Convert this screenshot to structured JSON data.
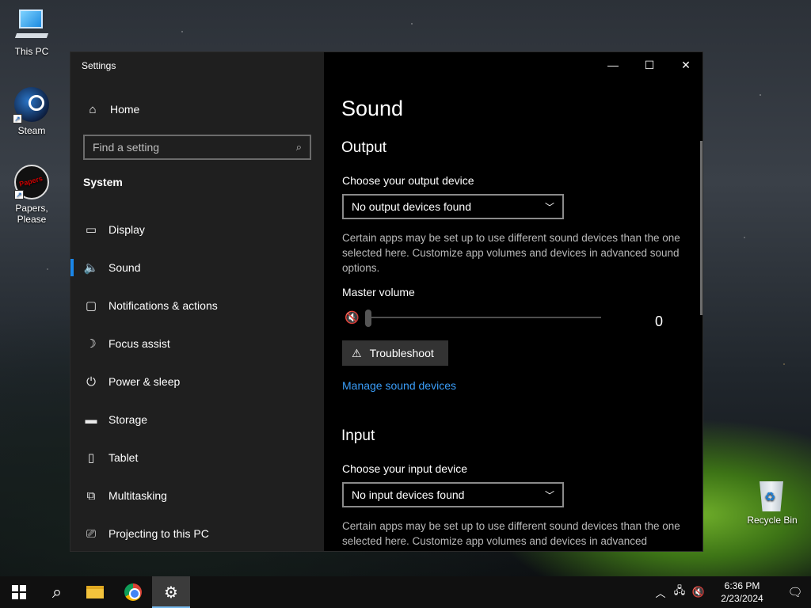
{
  "desktop": {
    "icons": [
      {
        "label": "This PC"
      },
      {
        "label": "Steam"
      },
      {
        "label": "Papers, Please"
      },
      {
        "label": "Recycle Bin"
      }
    ]
  },
  "window": {
    "app_title": "Settings",
    "controls": {
      "minimize": "—",
      "maximize": "☐",
      "close": "✕"
    }
  },
  "sidebar": {
    "home_label": "Home",
    "search_placeholder": "Find a setting",
    "section": "System",
    "items": [
      {
        "label": "Display",
        "icon": "display-icon"
      },
      {
        "label": "Sound",
        "icon": "speaker-icon",
        "active": true
      },
      {
        "label": "Notifications & actions",
        "icon": "notifications-icon"
      },
      {
        "label": "Focus assist",
        "icon": "moon-icon"
      },
      {
        "label": "Power & sleep",
        "icon": "power-icon"
      },
      {
        "label": "Storage",
        "icon": "storage-icon"
      },
      {
        "label": "Tablet",
        "icon": "tablet-icon"
      },
      {
        "label": "Multitasking",
        "icon": "multitasking-icon"
      },
      {
        "label": "Projecting to this PC",
        "icon": "projecting-icon"
      }
    ]
  },
  "sound": {
    "title": "Sound",
    "output": {
      "heading": "Output",
      "device_label": "Choose your output device",
      "device_value": "No output devices found",
      "description": "Certain apps may be set up to use different sound devices than the one selected here. Customize app volumes and devices in advanced sound options.",
      "master_volume_label": "Master volume",
      "volume_value": "0",
      "volume_level": 0,
      "troubleshoot_label": "Troubleshoot",
      "manage_link": "Manage sound devices"
    },
    "input": {
      "heading": "Input",
      "device_label": "Choose your input device",
      "device_value": "No input devices found",
      "description": "Certain apps may be set up to use different sound devices than the one selected here. Customize app volumes and devices in advanced"
    }
  },
  "taskbar": {
    "time": "6:36 PM",
    "date": "2/23/2024"
  },
  "colors": {
    "accent": "#1a86e8",
    "link": "#3a9df8",
    "sidebar_bg": "#1f1f1f",
    "content_bg": "#000000"
  }
}
